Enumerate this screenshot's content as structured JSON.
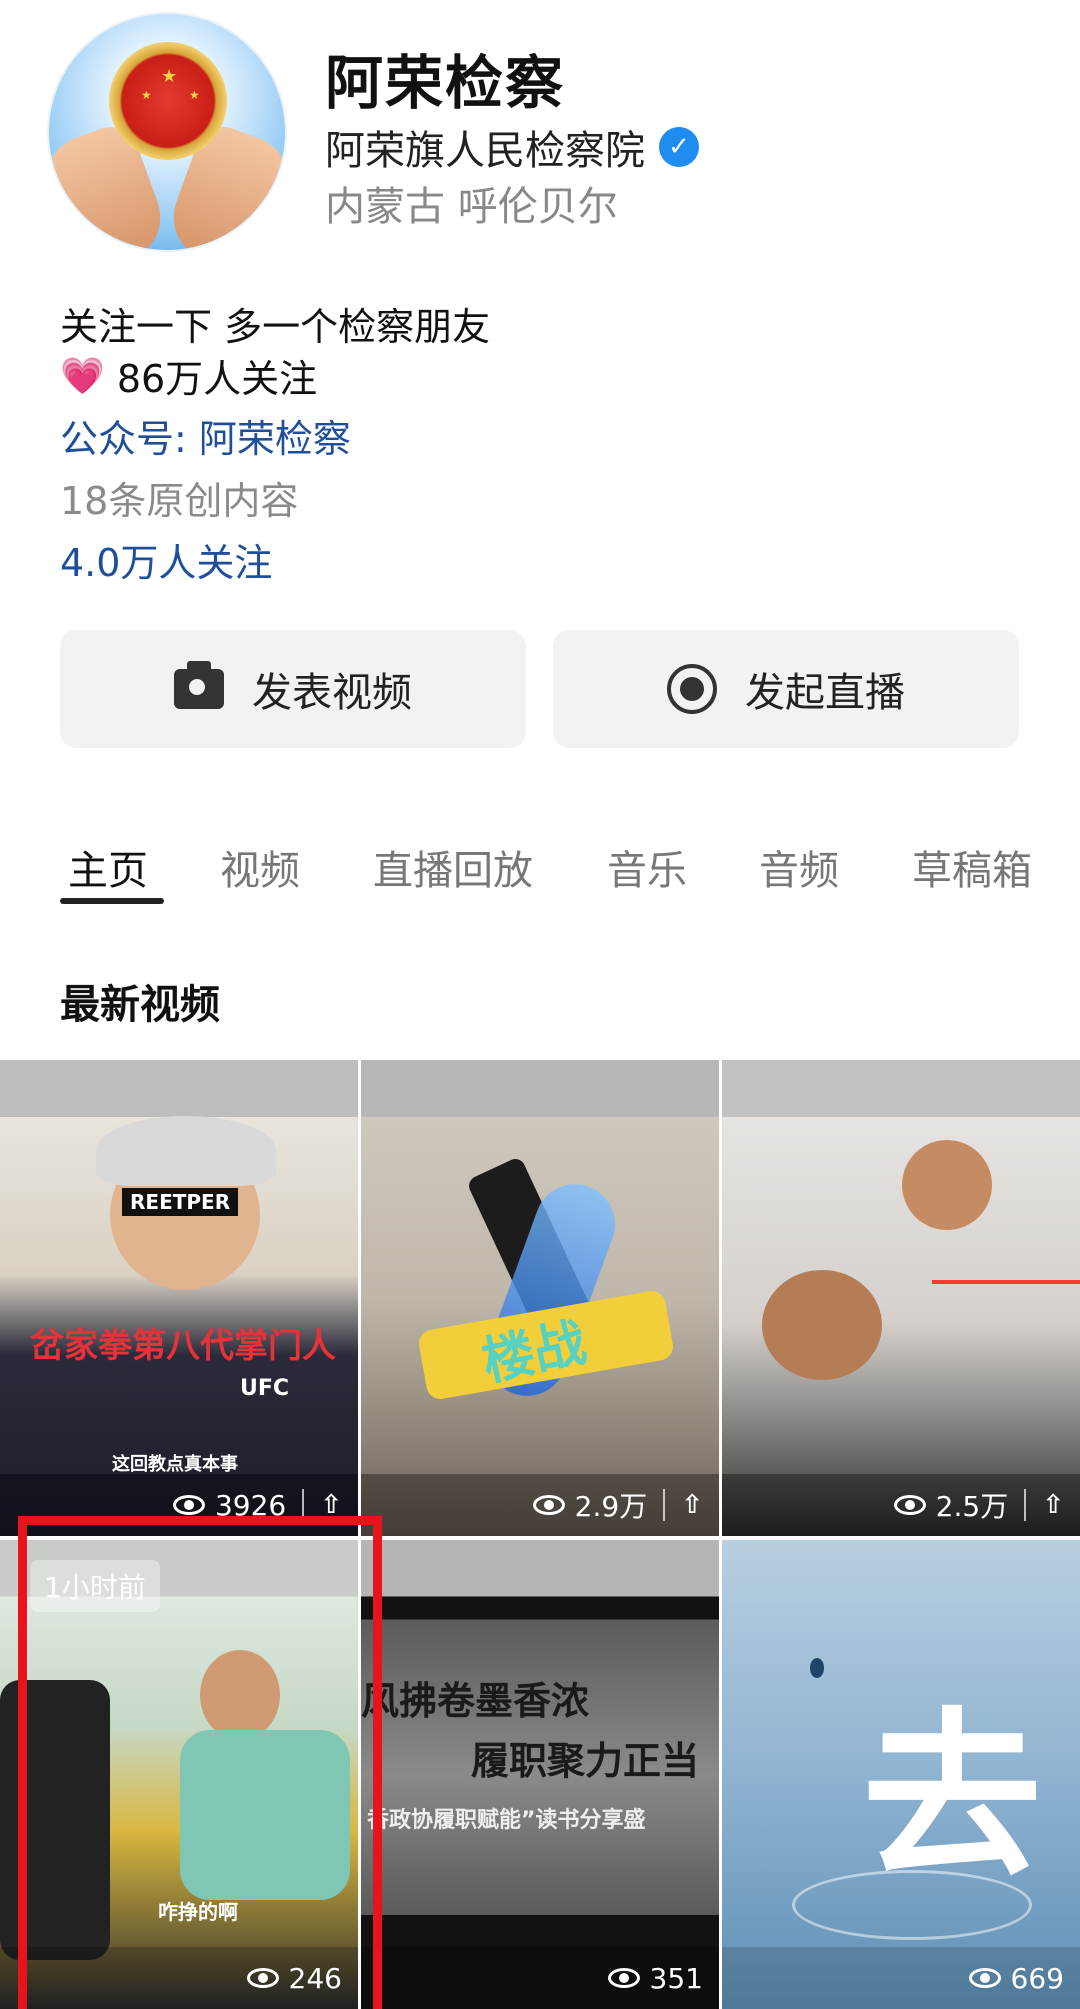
{
  "profile": {
    "name": "阿荣检察",
    "organization": "阿荣旗人民检察院",
    "location": "内蒙古 呼伦贝尔",
    "verified_icon": "verified-icon",
    "avatar_icon": "procuratorate-emblem"
  },
  "bio": {
    "line1": "关注一下 多一个检察朋友",
    "fans": "86万人关注",
    "gzh": "公众号: 阿荣检察",
    "original_count": "18条原创内容",
    "followers": "4.0万人关注"
  },
  "actions": {
    "publish_video": "发表视频",
    "start_live": "发起直播"
  },
  "tabs": [
    "主页",
    "视频",
    "直播回放",
    "音乐",
    "音频",
    "草稿箱"
  ],
  "active_tab": "主页",
  "section_title": "最新视频",
  "videos": [
    {
      "views": "3926",
      "caption": "岔家拳第八代掌门人",
      "subcaption": "这回教点真本事",
      "shirt": "UFC",
      "headband": "REETPER"
    },
    {
      "views": "2.9万",
      "caption": "楼战"
    },
    {
      "views": "2.5万"
    },
    {
      "views": "246",
      "time_badge": "1小时前",
      "subcaption": "咋挣的啊"
    },
    {
      "views": "351",
      "caption": "风拂卷墨香浓",
      "caption2": "履职聚力正当",
      "caption3": "香政协履职赋能”读书分享盛"
    },
    {
      "views": "669",
      "caption": "去"
    }
  ],
  "colors": {
    "link_blue": "#1f4f9b",
    "verified_blue": "#1f8cf0",
    "highlight_red": "#e8141c"
  }
}
